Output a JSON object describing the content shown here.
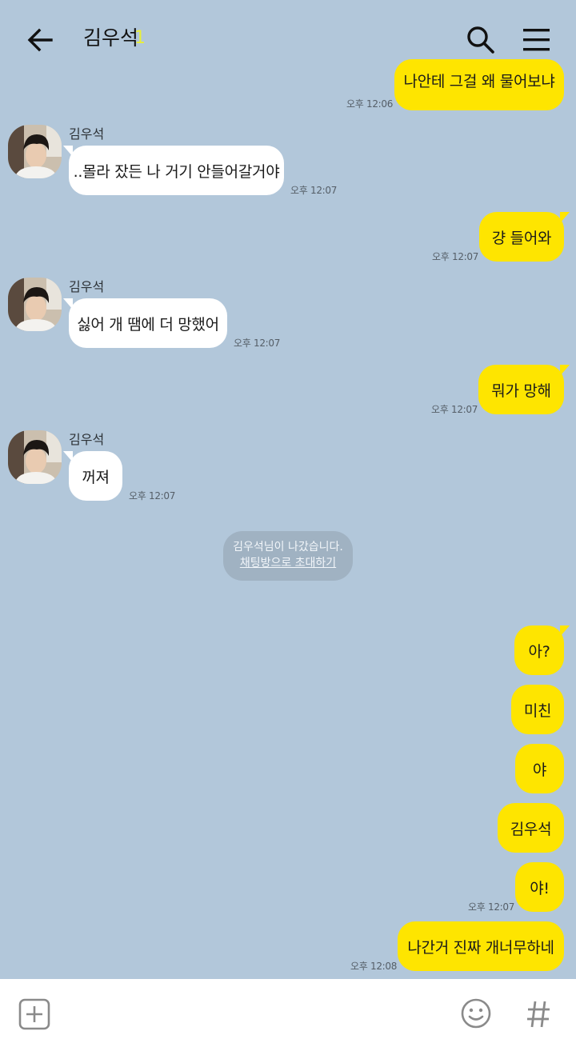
{
  "header": {
    "title": "김우석",
    "member_count": "1",
    "icons": {
      "back": "back-arrow-icon",
      "search": "search-icon",
      "menu": "hamburger-menu-icon"
    }
  },
  "messages": [
    {
      "from": "me",
      "text": "나안테 그걸 왜 물어보냐",
      "time": "오후 12:06"
    },
    {
      "from": "other",
      "sender": "김우석",
      "text": "..몰라 잤든 나 거기 안들어갈거야",
      "time": "오후 12:07"
    },
    {
      "from": "me",
      "text": "걍 들어와",
      "time": "오후 12:07"
    },
    {
      "from": "other",
      "sender": "김우석",
      "text": "싫어 개 땜에 더 망했어",
      "time": "오후 12:07"
    },
    {
      "from": "me",
      "text": "뭐가 망해",
      "time": "오후 12:07"
    },
    {
      "from": "other",
      "sender": "김우석",
      "text": "꺼져",
      "time": "오후 12:07"
    },
    {
      "from": "me",
      "text": "아?"
    },
    {
      "from": "me",
      "text": "미친"
    },
    {
      "from": "me",
      "text": "야"
    },
    {
      "from": "me",
      "text": "김우석"
    },
    {
      "from": "me",
      "text": "야!",
      "time": "오후 12:07"
    },
    {
      "from": "me",
      "text": "나간거 진짜 개너무하네",
      "time": "오후 12:08"
    }
  ],
  "system_notice": {
    "text": "김우석님이 나갔습니다.",
    "invite_link": "채팅방으로 초대하기"
  },
  "input_bar": {
    "icons": {
      "attach": "plus-square-icon",
      "emoji": "smiley-icon",
      "hashtag": "hashtag-icon"
    }
  },
  "colors": {
    "background": "#b2c7da",
    "my_bubble": "#fee500",
    "other_bubble": "#ffffff",
    "member_count": "#e8ef3a"
  }
}
